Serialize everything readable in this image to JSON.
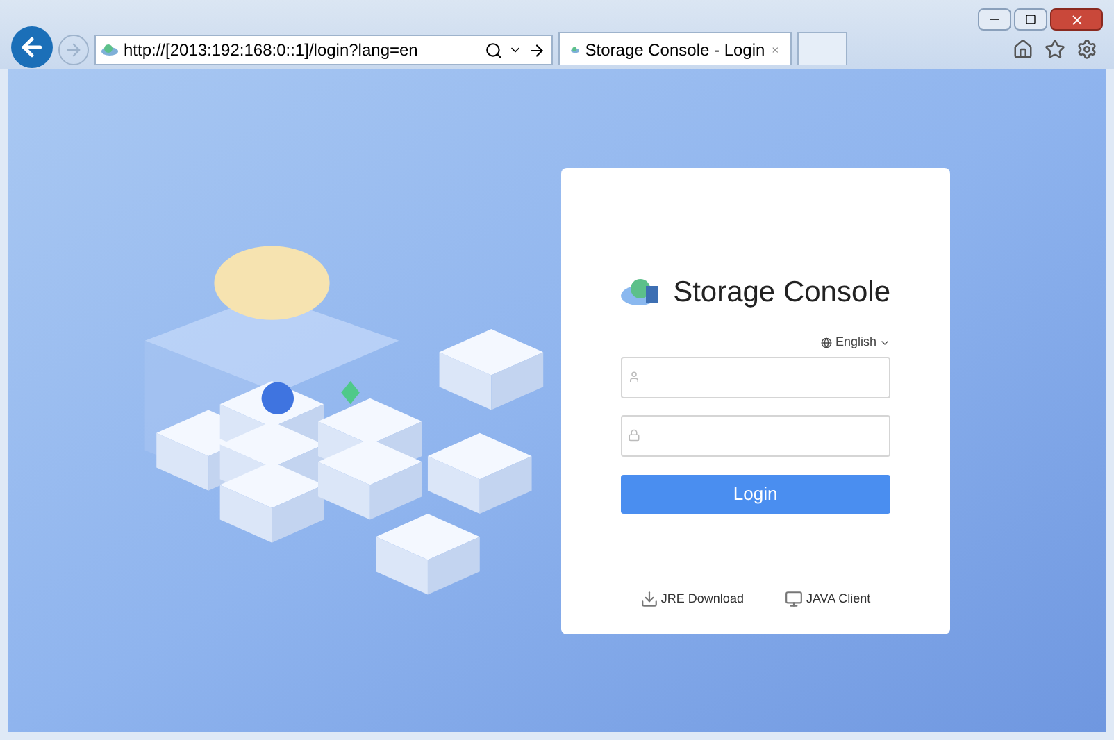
{
  "browser": {
    "address": "http://[2013:192:168:0::1]/login?lang=en",
    "tabs": [
      {
        "label": "Storage Console - Login",
        "selected": true
      }
    ]
  },
  "login": {
    "title": "Storage Console",
    "language": "English",
    "submit": "Login",
    "links": [
      {
        "kind": "download",
        "label": "JRE Download"
      },
      {
        "kind": "client",
        "label": "JAVA Client"
      }
    ]
  }
}
